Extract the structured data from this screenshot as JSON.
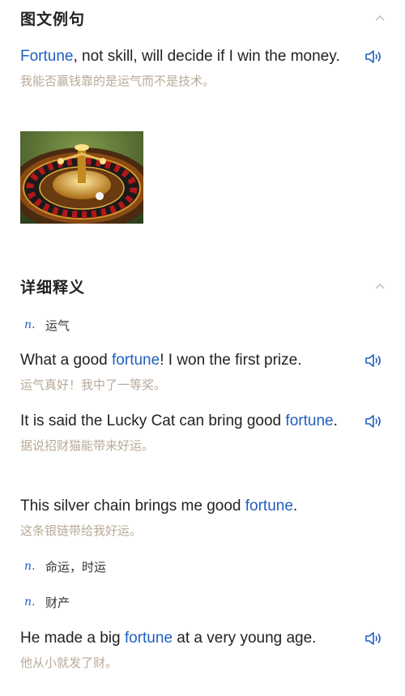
{
  "sections": {
    "examples_title": "图文例句",
    "details_title": "详细释义"
  },
  "examples": [
    {
      "pre": "",
      "kw": "Fortune",
      "post": ", not skill, will decide if I win the money.",
      "cn": "我能否赢钱靠的是运气而不是技术。"
    }
  ],
  "senses": [
    {
      "pos": "n.",
      "meaning": "运气",
      "examples": [
        {
          "pre": "What a good ",
          "kw": "fortune",
          "post": "! I won the first prize.",
          "cn": "运气真好！我中了一等奖。"
        },
        {
          "pre": "It is said the Lucky Cat can bring good ",
          "kw": "fortune",
          "post": ".",
          "cn": "据说招财猫能带来好运。"
        },
        {
          "pre": "This silver chain brings me good ",
          "kw": "fortune",
          "post": ".",
          "cn": "这条银链带给我好运。"
        }
      ]
    },
    {
      "pos": "n.",
      "meaning": "命运，时运",
      "examples": []
    },
    {
      "pos": "n.",
      "meaning": "财产",
      "examples": [
        {
          "pre": "He made a big ",
          "kw": "fortune",
          "post": " at a very young age.",
          "cn": "他从小就发了财。"
        }
      ]
    }
  ],
  "colors": {
    "keyword": "#1f5fbf",
    "translation": "#b8aa98",
    "icon": "#1f5fbf"
  },
  "icons": {
    "collapse": "chevron-up-icon",
    "audio": "speaker-icon"
  }
}
